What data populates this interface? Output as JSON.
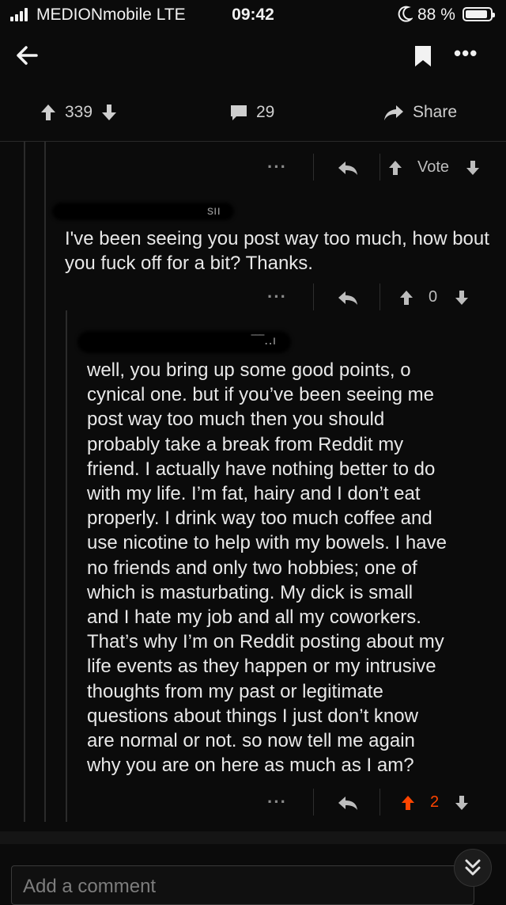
{
  "status_bar": {
    "carrier": "MEDIONmobile  LTE",
    "time": "09:42",
    "battery": "88 %"
  },
  "nav": {
    "back_icon": "arrow-left-icon",
    "bookmark_icon": "bookmark-icon",
    "more_icon": "more-horizontal-icon"
  },
  "post_actions": {
    "upvotes": "339",
    "comments": "29",
    "share": "Share"
  },
  "comments": [
    {
      "vote_label": "Vote",
      "username_hint": "sıı"
    },
    {
      "text": "I've been seeing you post way too much, how bout you fuck off for a bit? Thanks.",
      "score": "0",
      "username_hint": "‾‾‾․․ı"
    },
    {
      "text_lines": [
        "well, you bring up some good points, o",
        "cynical one. but if you’ve been seeing me",
        "post way too much then you should",
        "probably take a break from Reddit my",
        "friend. I actually have nothing better to do",
        "with my life. I’m fat, hairy and I don’t eat",
        "properly. I drink way too much coffee and",
        "use nicotine to help with my bowels. I have",
        "no friends and only two hobbies; one of",
        "which is masturbating.  My dick is small",
        "and I hate my job and all my coworkers.",
        "That’s why I’m on Reddit posting about my",
        "life events as they happen or my intrusive",
        "thoughts from my past or legitimate",
        "questions about things I just don’t know",
        "are normal or not. so now tell me again",
        "why you are on here as much as I am?"
      ],
      "score": "2",
      "upvote_color": "#ff4500"
    }
  ],
  "composer": {
    "placeholder": "Add a comment"
  }
}
